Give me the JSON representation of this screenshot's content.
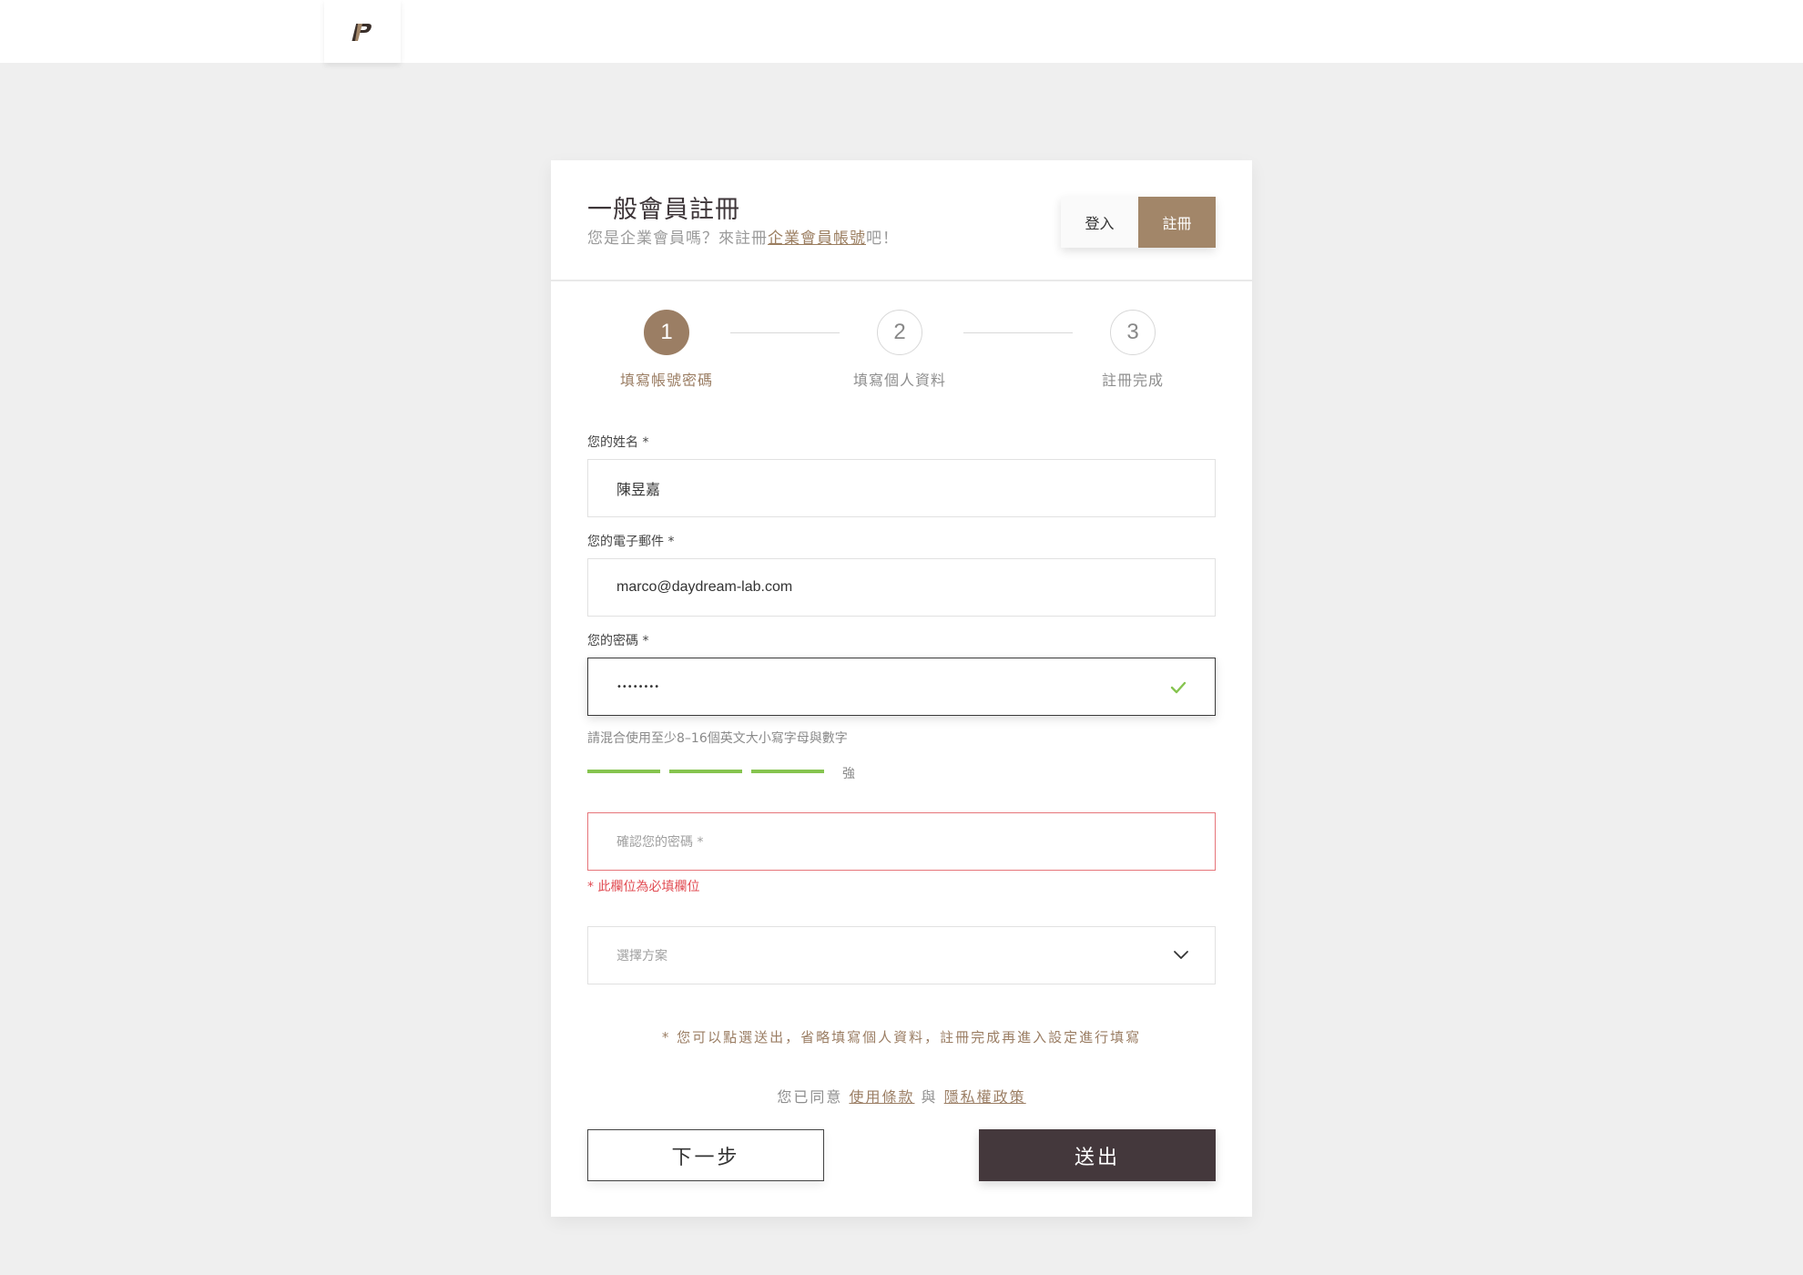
{
  "header": {
    "logo_letter": "p",
    "logo_color": "#3a2f2a"
  },
  "card": {
    "title": "一般會員註冊",
    "subtitle_prefix": "您是企業會員嗎？來註冊",
    "subtitle_link": "企業會員帳號",
    "subtitle_suffix": "吧！",
    "toggle": {
      "login_label": "登入",
      "register_label": "註冊"
    }
  },
  "steps": [
    {
      "number": "1",
      "label": "填寫帳號密碼",
      "active": true
    },
    {
      "number": "2",
      "label": "填寫個人資料",
      "active": false
    },
    {
      "number": "3",
      "label": "註冊完成",
      "active": false
    }
  ],
  "form": {
    "name": {
      "label": "您的姓名 *",
      "value": "陳昱嘉"
    },
    "email": {
      "label": "您的電子郵件 *",
      "value": "marco@daydream-lab.com"
    },
    "password": {
      "label": "您的密碼 *",
      "value": "••••••••",
      "hint": "請混合使用至少8–16個英文大小寫字母與數字"
    },
    "strength": {
      "level": 3,
      "max": 3,
      "label": "強",
      "color": "#86c44f"
    },
    "confirm": {
      "placeholder": "確認您的密碼 *",
      "error": "* 此欄位為必填欄位"
    },
    "plan": {
      "placeholder": "選擇方案"
    }
  },
  "footer": {
    "note": "* 您可以點選送出，省略填寫個人資料，註冊完成再進入設定進行填寫",
    "agree_prefix": "您已同意",
    "terms_link": "使用條款",
    "agree_and": "與",
    "privacy_link": "隱私權政策",
    "next_label": "下一步",
    "submit_label": "送出"
  },
  "colors": {
    "accent": "#9b7e64",
    "dark_button": "#44383c",
    "success": "#86c44f",
    "error": "#e14b52"
  }
}
